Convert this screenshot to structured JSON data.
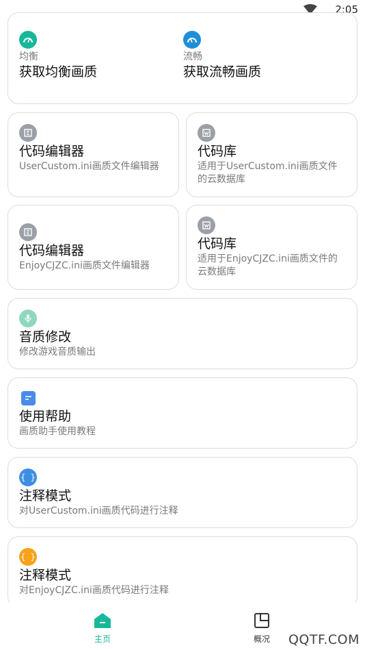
{
  "status_bar": {
    "time": "2:05"
  },
  "quality_card": {
    "left": {
      "label": "均衡",
      "title": "获取均衡画质"
    },
    "right": {
      "label": "流畅",
      "title": "获取流畅画质"
    }
  },
  "editor_row1": {
    "left": {
      "title": "代码编辑器",
      "desc": "UserCustom.ini画质文件编辑器"
    },
    "right": {
      "title": "代码库",
      "desc": "适用于UserCustom.ini画质文件的云数据库"
    }
  },
  "editor_row2": {
    "left": {
      "title": "代码编辑器",
      "desc": "EnjoyCJZC.ini画质文件编辑器"
    },
    "right": {
      "title": "代码库",
      "desc": "适用于EnjoyCJZC.ini画质文件的云数据库"
    }
  },
  "audio_card": {
    "title": "音质修改",
    "desc": "修改游戏音质输出"
  },
  "help_card": {
    "title": "使用帮助",
    "desc": "画质助手使用教程"
  },
  "comment_card1": {
    "title": "注释模式",
    "desc": "对UserCustom.ini画质代码进行注释"
  },
  "comment_card2": {
    "title": "注释模式",
    "desc": "对EnjoyCJZC.ini画质代码进行注释"
  },
  "bottom_nav": {
    "home": "主页",
    "overview": "概况"
  },
  "watermark": "QQTF.COM",
  "colors": {
    "teal": "#17b89a",
    "blue": "#1e8fd6",
    "gray": "#9aa0a6",
    "mint": "#8fd7bf",
    "help": "#4a8be8",
    "code_blue": "#3e8fe3",
    "orange": "#f6a21b"
  }
}
